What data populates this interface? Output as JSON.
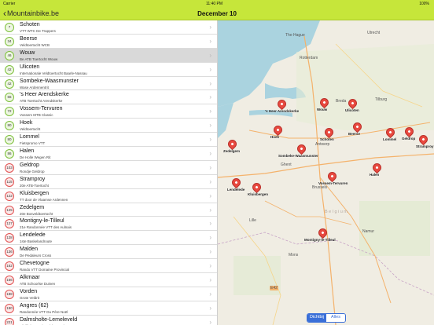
{
  "status": {
    "carrier": "Carrier",
    "time": "11:40 PM",
    "battery": "100%"
  },
  "nav": {
    "back_label": "Mountainbike.be",
    "title": "December 10"
  },
  "rides": [
    {
      "badge": "7",
      "name": "Schoten",
      "sub": "VTT WTC De Trappers",
      "green": true
    },
    {
      "badge": "34",
      "name": "Beerse",
      "sub": "Veldtoertocht WCB",
      "green": true
    },
    {
      "badge": "46",
      "name": "Wouw",
      "sub": "Be ATB Toertocht Wouw",
      "green": true,
      "selected": true
    },
    {
      "badge": "42",
      "name": "Ulicoten",
      "sub": "Internationale Veldtoertocht Baarle-Nassau",
      "green": true
    },
    {
      "badge": "42",
      "name": "Sombeke-Waasmunster",
      "sub": "Wase Ardennentrit",
      "green": true
    },
    {
      "badge": "66",
      "name": "'s Heer Arendskerke",
      "sub": "ATB Toertocht Arendskerke",
      "green": true
    },
    {
      "badge": "72",
      "name": "Vossem-Tervuren",
      "sub": "Vossem MTB Classic",
      "green": true
    },
    {
      "badge": "80",
      "name": "Hoek",
      "sub": "Veldtoertocht",
      "green": true
    },
    {
      "badge": "80",
      "name": "Lommel",
      "sub": "Fietspromo VTT",
      "green": true
    },
    {
      "badge": "86",
      "name": "Halen",
      "sub": "De Holle Wegen Rit",
      "green": true
    },
    {
      "badge": "103",
      "name": "Geldrop",
      "sub": "Rondje Geldrop",
      "green": false
    },
    {
      "badge": "115",
      "name": "Stramproy",
      "sub": "20e ATB-Toertocht",
      "green": false
    },
    {
      "badge": "122",
      "name": "Kluisbergen",
      "sub": "TT door de Vlaamse Ardennen",
      "green": false
    },
    {
      "badge": "125",
      "name": "Zedelgem",
      "sub": "20e Bosveldtoertocht",
      "green": false
    },
    {
      "badge": "127",
      "name": "Montigny-le-Tilleul",
      "sub": "21e Randonnée VTT des Aulnais",
      "green": false
    },
    {
      "badge": "128",
      "name": "Lendelede",
      "sub": "1ste Baskelandroute",
      "green": false
    },
    {
      "badge": "136",
      "name": "Malden",
      "sub": "De Pedaleurs Cross",
      "green": false
    },
    {
      "badge": "162",
      "name": "Chevetogne",
      "sub": "Rando VTT Domaine Provincial",
      "green": false
    },
    {
      "badge": "166",
      "name": "Alkmaar",
      "sub": "ATB Schoorlse Duinen",
      "green": false
    },
    {
      "badge": "188",
      "name": "Vorden",
      "sub": "Grote Veldrit",
      "green": false
    },
    {
      "badge": "190",
      "name": "Angres (62)",
      "sub": "Randonnée VTT Du Père Noël",
      "green": false
    },
    {
      "badge": "221",
      "name": "Dalmsholte-Lemeleveld",
      "sub": "Bijzillich Lemelerveld ATB-KlauTop",
      "green": false
    }
  ],
  "map": {
    "pins": [
      {
        "label": "Wouw"
      },
      {
        "label": "Ulicoten"
      },
      {
        "label": "'s Heer Arendskerke"
      },
      {
        "label": "Geldrop"
      },
      {
        "label": "Schoten"
      },
      {
        "label": "Hoek"
      },
      {
        "label": "Beerse"
      },
      {
        "label": "Lommel"
      },
      {
        "label": "Stramproy"
      },
      {
        "label": "Zedelgem"
      },
      {
        "label": "Sombeke-Waasmunster"
      },
      {
        "label": "Halen"
      },
      {
        "label": "Lendelede"
      },
      {
        "label": "Kluisbergen"
      },
      {
        "label": "Vossem-Tervuren"
      },
      {
        "label": "Montigny-le-Tilleul"
      }
    ],
    "cities": [
      "The Hague",
      "Utrecht",
      "Rotterdam",
      "Breda",
      "Tilburg",
      "Ghent",
      "Antwerp",
      "Brussels",
      "Belgium",
      "Lille",
      "Mons",
      "Namur"
    ],
    "tabs": {
      "nearby": "Dichtbij",
      "all": "Alles"
    },
    "road_label": "E42"
  },
  "colors": {
    "accent": "#c6e63a",
    "pin": "#e8493f",
    "selected_row": "#d9d9d9",
    "segment": "#3a6fd8"
  }
}
